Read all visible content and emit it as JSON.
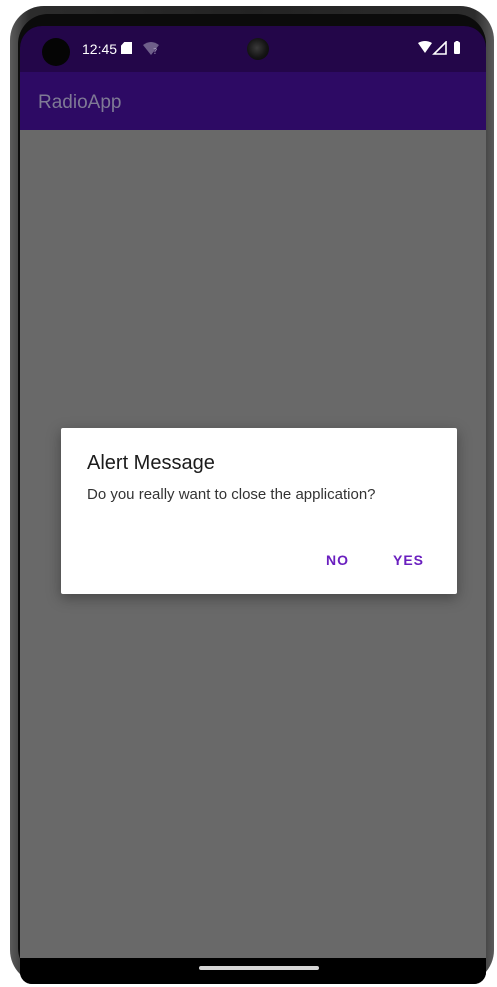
{
  "status_bar": {
    "time": "12:45",
    "icons": [
      "sd-card-icon",
      "wifi-question-icon",
      "wifi-icon",
      "signal-icon",
      "battery-icon"
    ]
  },
  "app_bar": {
    "title": "RadioApp"
  },
  "dialog": {
    "title": "Alert Message",
    "message": "Do you really want to close the application?",
    "buttons": {
      "no": "NO",
      "yes": "YES"
    }
  },
  "colors": {
    "status_bar": "#230649",
    "app_bar": "#2d0a64",
    "scrim": "#696969",
    "accent": "#6a1fbf"
  }
}
